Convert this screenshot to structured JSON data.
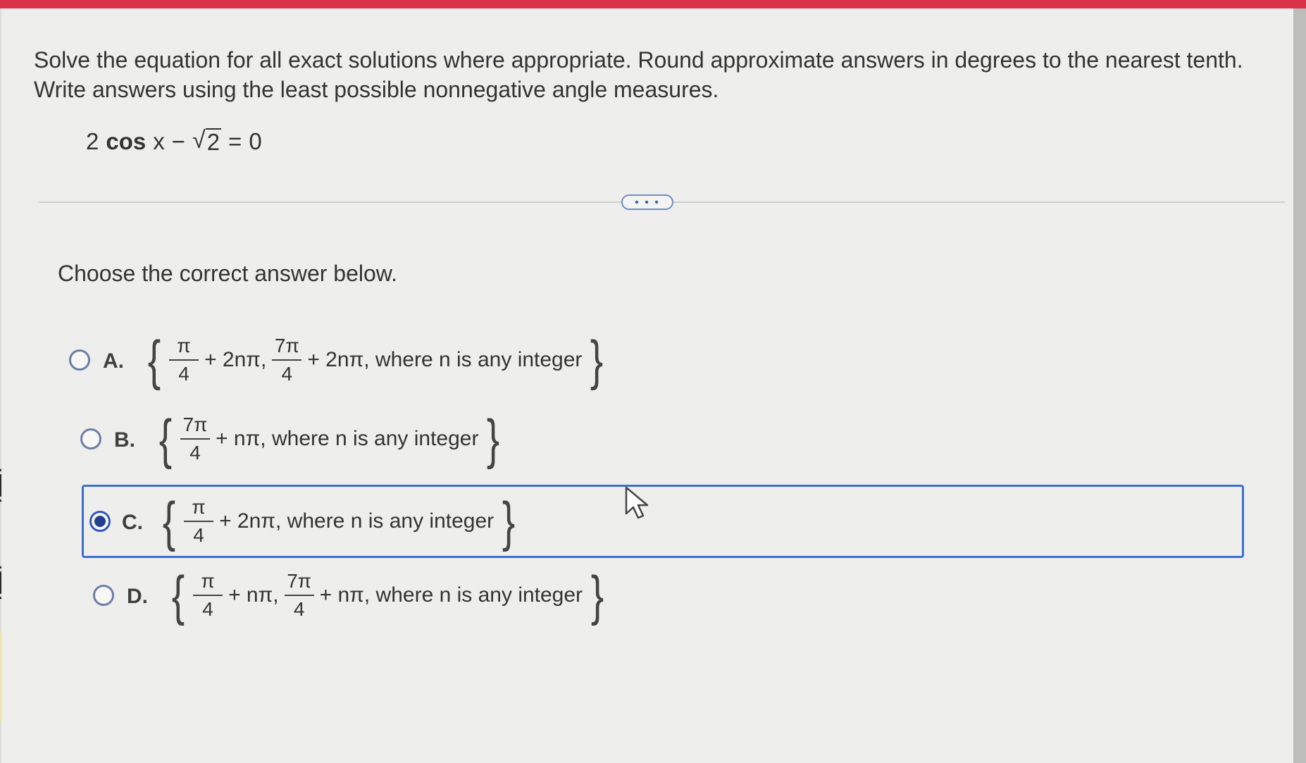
{
  "colors": {
    "top_bar": "#d9314a",
    "selection_border": "#3d6fd2",
    "radio_selected": "#233f8f",
    "more_button": "#6d8fc6"
  },
  "instructions": "Solve the equation for all exact solutions where appropriate. Round approximate answers in degrees to the nearest tenth. Write answers using the least possible nonnegative angle measures.",
  "equation": {
    "coefficient": "2",
    "function": "cos",
    "variable": "x",
    "operator": "−",
    "radicand": "2",
    "equals": "=",
    "result": "0"
  },
  "more_button_label": "• • •",
  "prompt": "Choose the correct answer below.",
  "options": [
    {
      "letter": "A.",
      "selected": false,
      "open_brace": "{",
      "frac1_num": "π",
      "frac1_den": "4",
      "term1": "+ 2nπ,",
      "frac2_num": "7π",
      "frac2_den": "4",
      "term2": "+ 2nπ, where n is any integer",
      "close_brace": "}"
    },
    {
      "letter": "B.",
      "selected": false,
      "open_brace": "{",
      "frac1_num": "7π",
      "frac1_den": "4",
      "term1": "+ nπ, where n is any integer",
      "close_brace": "}"
    },
    {
      "letter": "C.",
      "selected": true,
      "open_brace": "{",
      "frac1_num": "π",
      "frac1_den": "4",
      "term1": "+ 2nπ, where n is any integer",
      "close_brace": "}"
    },
    {
      "letter": "D.",
      "selected": false,
      "open_brace": "{",
      "frac1_num": "π",
      "frac1_den": "4",
      "term1": "+ nπ,",
      "frac2_num": "7π",
      "frac2_den": "4",
      "term2": "+ nπ, where n is any integer",
      "close_brace": "}"
    }
  ],
  "icons": {
    "cursor": "arrow-cursor-icon"
  }
}
